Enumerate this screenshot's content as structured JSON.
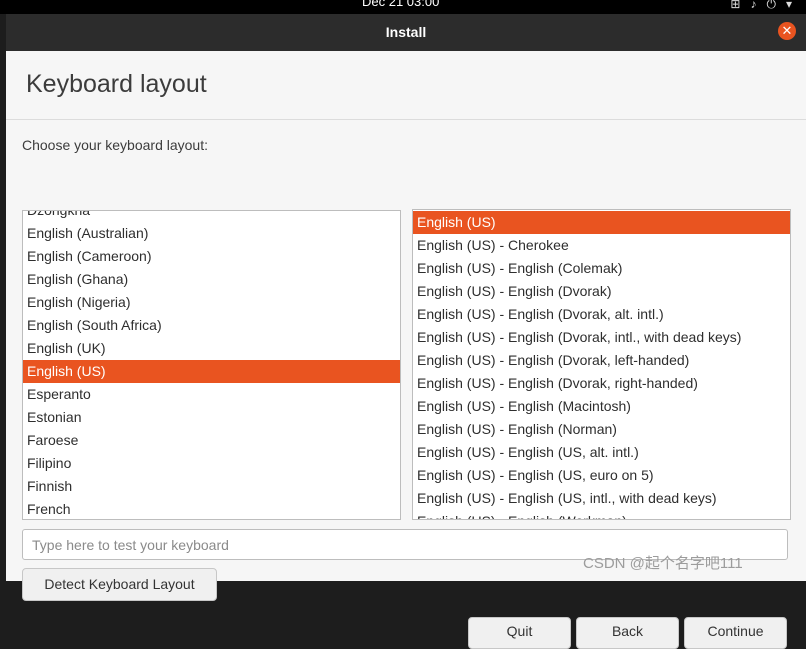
{
  "topbar": {
    "clock": "Dec 21 03:00",
    "tray_icons": [
      "network-icon",
      "volume-icon",
      "power-icon",
      "chevron-down-icon"
    ]
  },
  "window": {
    "title": "Install",
    "close_icon": "close-icon"
  },
  "page": {
    "heading": "Keyboard layout",
    "prompt": "Choose your keyboard layout:"
  },
  "layouts": {
    "items": [
      "Dzongkha",
      "English (Australian)",
      "English (Cameroon)",
      "English (Ghana)",
      "English (Nigeria)",
      "English (South Africa)",
      "English (UK)",
      "English (US)",
      "Esperanto",
      "Estonian",
      "Faroese",
      "Filipino",
      "Finnish",
      "French"
    ],
    "selected": "English (US)"
  },
  "variants": {
    "items": [
      "English (US)",
      "English (US) - Cherokee",
      "English (US) - English (Colemak)",
      "English (US) - English (Dvorak)",
      "English (US) - English (Dvorak, alt. intl.)",
      "English (US) - English (Dvorak, intl., with dead keys)",
      "English (US) - English (Dvorak, left-handed)",
      "English (US) - English (Dvorak, right-handed)",
      "English (US) - English (Macintosh)",
      "English (US) - English (Norman)",
      "English (US) - English (US, alt. intl.)",
      "English (US) - English (US, euro on 5)",
      "English (US) - English (US, intl., with dead keys)",
      "English (US) - English (Workman)"
    ],
    "selected": "English (US)"
  },
  "test_input": {
    "placeholder": "Type here to test your keyboard",
    "value": ""
  },
  "buttons": {
    "detect": "Detect Keyboard Layout",
    "quit": "Quit",
    "back": "Back",
    "continue": "Continue"
  },
  "watermark": "CSDN @起个名字吧111",
  "colors": {
    "accent": "#e95420",
    "titlebar": "#2c2c2c",
    "background": "#f6f6f6"
  }
}
